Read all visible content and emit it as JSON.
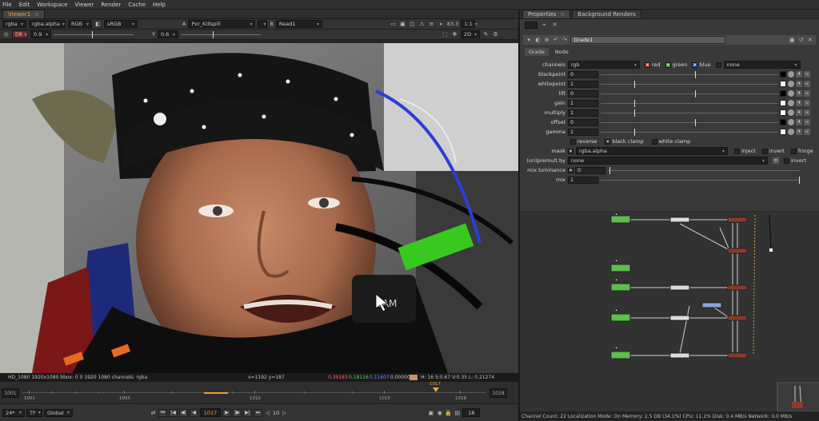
{
  "menu": [
    "File",
    "Edit",
    "Workspace",
    "Viewer",
    "Render",
    "Cache",
    "Help"
  ],
  "viewer": {
    "tab_label": "Viewer1",
    "toolbar1": {
      "channels": "rgba",
      "alpha": "rgba.alpha",
      "colorspace": "RGB",
      "lut": "sRGB",
      "input_a": "Pxr_Killspill",
      "input_b": "Read1",
      "zoom": "83.3",
      "scale": "1:1"
    },
    "toolbar2": {
      "fstop_label": "f/8",
      "gain": "0.9",
      "gamma_label": "Y",
      "gamma": "0.6",
      "view_mode": "2D"
    },
    "overlay_label": "SAM",
    "status": {
      "format": "HD_1080 1920x1080 bbox: 0 0 1920 1080 channels: rgba",
      "coords": "x=1192 y=187",
      "r": "0.39183",
      "g": "0.18116",
      "b": "0.11607",
      "a": "0.00000",
      "hsvl": "H: 16 S:0.67 V:0.35  L: 0.21274"
    },
    "timeline": {
      "start": "1001",
      "end": "1018",
      "current": "1017",
      "ticks": [
        "1001",
        "1005",
        "1010",
        "1015",
        "1018"
      ]
    },
    "playback": {
      "fps": "24*",
      "time_mode": "TF",
      "range": "Global",
      "frame": "1017",
      "increment": "10",
      "end_frame": "18"
    }
  },
  "properties": {
    "tabs": [
      "Properties",
      "Background Renders"
    ],
    "node_name": "Grade1",
    "subtabs": [
      "Grade",
      "Node"
    ],
    "channels_label": "channels",
    "channels_value": "rgb",
    "channel_red": "red",
    "channel_green": "green",
    "channel_blue": "blue",
    "channel_extra": "none",
    "knobs": [
      {
        "label": "blackpoint",
        "value": "0",
        "swatch": "#000000"
      },
      {
        "label": "whitepoint",
        "value": "1",
        "swatch": "#ffffff"
      },
      {
        "label": "lift",
        "value": "0",
        "swatch": "#000000"
      },
      {
        "label": "gain",
        "value": "1",
        "swatch": "#ffffff"
      },
      {
        "label": "multiply",
        "value": "1",
        "swatch": "#ffffff"
      },
      {
        "label": "offset",
        "value": "0",
        "swatch": "#000000"
      },
      {
        "label": "gamma",
        "value": "1",
        "swatch": "#ffffff"
      }
    ],
    "reverse_label": "reverse",
    "black_clamp_label": "black clamp",
    "white_clamp_label": "white clamp",
    "mask_label": "mask",
    "mask_value": "rgba.alpha",
    "inject_label": "inject",
    "invert_label": "invert",
    "fringe_label": "fringe",
    "unpremult_label": "(un)premult by",
    "unpremult_value": "none",
    "unpremult_invert_label": "invert",
    "mix_luminance_label": "mix luminance",
    "mix_luminance_value": "0",
    "mix_label": "mix",
    "mix_value": "1"
  },
  "status_bar": "Channel Count: 22  Localization Mode: On  Memory: 2.5 GB (34.1%)  CPU: 11.1%  Disk: 0.4 MB/s  Network: 0.0 MB/s"
}
